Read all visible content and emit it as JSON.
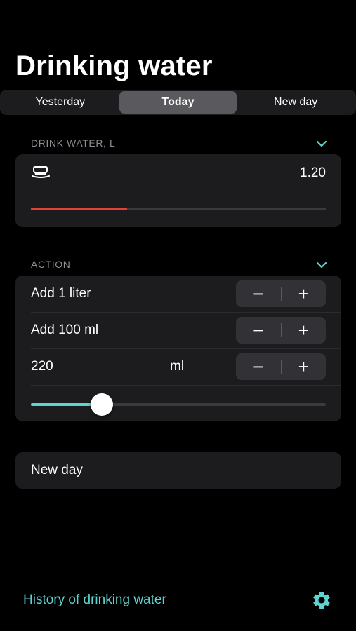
{
  "header": {
    "title": "Drinking water"
  },
  "tabs": [
    {
      "label": "Yesterday",
      "active": false
    },
    {
      "label": "Today",
      "active": true
    },
    {
      "label": "New day",
      "active": false
    }
  ],
  "drink_section": {
    "label": "DRINK WATER, L",
    "value": "1.20",
    "progress_fraction": 0.325,
    "progress_color": "#e5403a",
    "icon": "cup-icon"
  },
  "action_section": {
    "label": "ACTION",
    "rows": [
      {
        "label": "Add 1 liter"
      },
      {
        "label": "Add 100 ml"
      },
      {
        "label": "220",
        "unit": "ml"
      }
    ],
    "stepper": {
      "minus": "−",
      "plus": "+"
    },
    "slider_fraction": 0.24,
    "slider_color": "#5fd3cf"
  },
  "new_day_button": {
    "label": "New day"
  },
  "footer": {
    "history_link": "History of drinking water",
    "accent": "#5fd3cf",
    "settings_icon": "gear-icon"
  }
}
